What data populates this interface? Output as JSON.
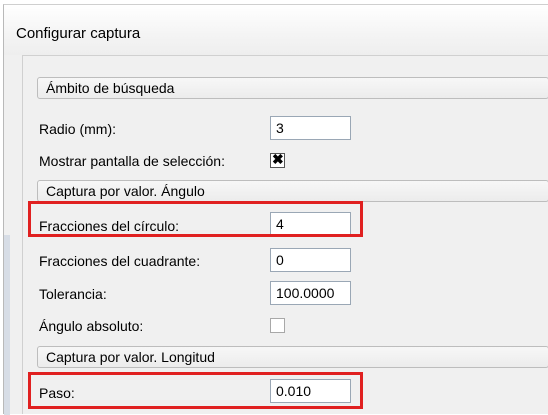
{
  "window": {
    "title": "Configurar captura"
  },
  "sections": {
    "scope": "Ámbito de búsqueda",
    "angle": "Captura por valor. Ángulo",
    "length": "Captura por valor. Longitud"
  },
  "fields": {
    "radius": {
      "label": "Radio (mm):",
      "value": "3"
    },
    "show_selection": {
      "label": "Mostrar pantalla de selección:",
      "checked": true,
      "mark": "✖"
    },
    "circle_fractions": {
      "label": "Fracciones del círculo:",
      "value": "4"
    },
    "quadrant_fractions": {
      "label": "Fracciones del cuadrante:",
      "value": "0"
    },
    "tolerance": {
      "label": "Tolerancia:",
      "value": "100.0000"
    },
    "absolute_angle": {
      "label": "Ángulo absoluto:",
      "checked": false
    },
    "step": {
      "label": "Paso:",
      "value": "0.010"
    }
  },
  "colors": {
    "highlight": "#e02020"
  }
}
